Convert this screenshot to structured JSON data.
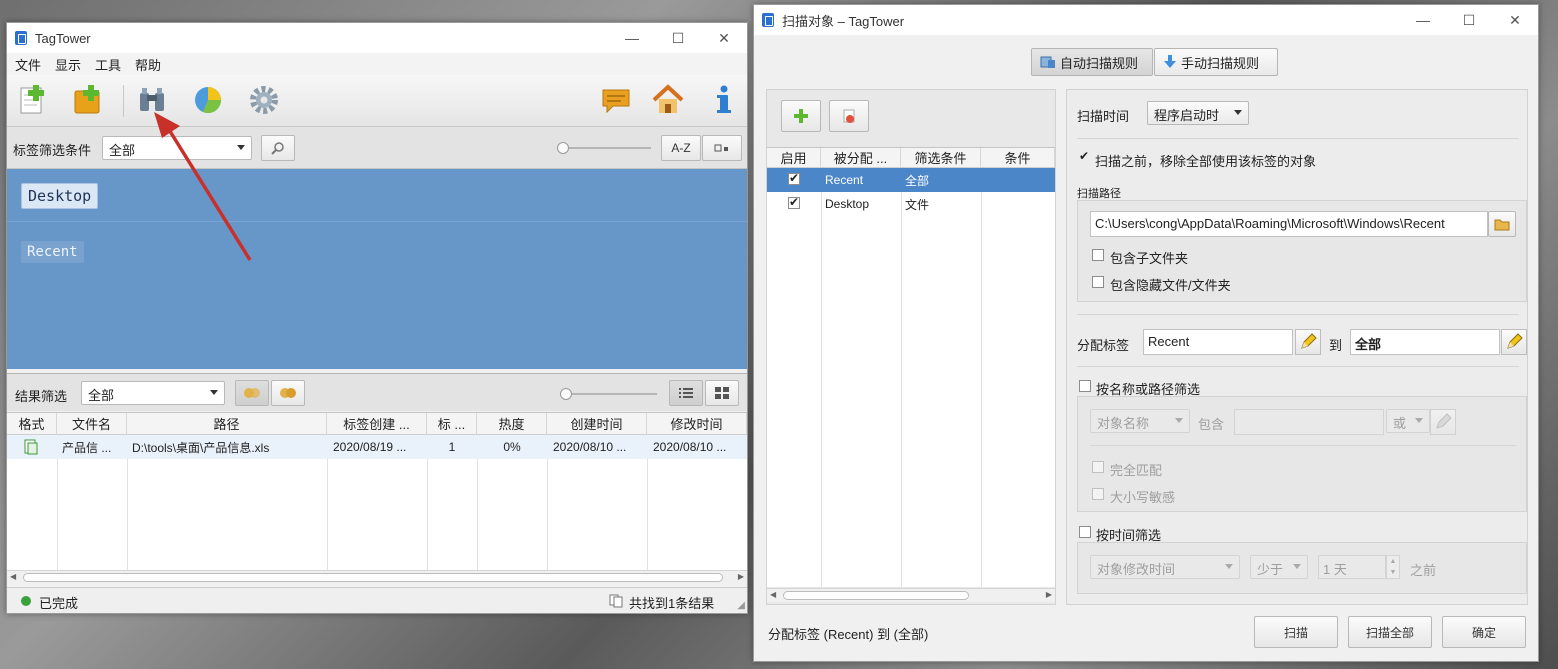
{
  "main_window": {
    "title": "TagTower",
    "menu": [
      "文件",
      "显示",
      "工具",
      "帮助"
    ],
    "toolbar_icons": [
      "new-icon",
      "add-folder-icon",
      "binoculars-icon",
      "pie-chart-icon",
      "gear-icon",
      "speech-bubble-icon",
      "home-icon",
      "info-icon"
    ],
    "tag_filter": {
      "label": "标签筛选条件",
      "value": "全部",
      "sort_label": "A-Z"
    },
    "tags": [
      "Desktop",
      "Recent"
    ],
    "results_filter": {
      "label": "结果筛选",
      "value": "全部"
    },
    "columns": [
      "格式",
      "文件名",
      "路径",
      "标签创建 ...",
      "标 ...",
      "热度",
      "创建时间",
      "修改时间"
    ],
    "rows": [
      {
        "filename": "产品信 ...",
        "path": "D:\\tools\\桌面\\产品信息.xls",
        "tag_created": "2020/08/19 ...",
        "tag_count": "1",
        "heat": "0%",
        "created": "2020/08/10 ...",
        "modified": "2020/08/10 ..."
      }
    ],
    "status": {
      "text": "已完成",
      "result_text": "共找到1条结果",
      "ok_color": "#3aa23a"
    }
  },
  "scan_window": {
    "title": "扫描对象 – TagTower",
    "tabs": [
      "自动扫描规则",
      "手动扫描规则"
    ],
    "rule_columns": [
      "启用",
      "被分配 ...",
      "筛选条件",
      "条件"
    ],
    "rules": [
      {
        "enabled": true,
        "tag": "Recent",
        "filter": "全部"
      },
      {
        "enabled": true,
        "tag": "Desktop",
        "filter": "文件"
      }
    ],
    "scan_time": {
      "label": "扫描时间",
      "value": "程序启动时"
    },
    "remove_before_scan": "扫描之前，移除全部使用该标签的对象",
    "scan_path": {
      "label": "扫描路径",
      "value": "C:\\Users\\cong\\AppData\\Roaming\\Microsoft\\Windows\\Recent",
      "include_subfolders": "包含子文件夹",
      "include_hidden": "包含隐藏文件/文件夹"
    },
    "assign": {
      "label": "分配标签",
      "tag": "Recent",
      "to": "到",
      "target": "全部"
    },
    "name_filter": {
      "label": "按名称或路径筛选",
      "field": "对象名称",
      "contains": "包含",
      "or": "或",
      "exact": "完全匹配",
      "case": "大小写敏感"
    },
    "time_filter": {
      "label": "按时间筛选",
      "field": "对象修改时间",
      "compare": "少于",
      "amount": "1 天",
      "suffix": "之前"
    },
    "footer": {
      "summary": "分配标签 (Recent) 到 (全部)",
      "scan": "扫描",
      "scan_all": "扫描全部",
      "ok": "确定"
    },
    "accent_color": "#4a86c8"
  }
}
